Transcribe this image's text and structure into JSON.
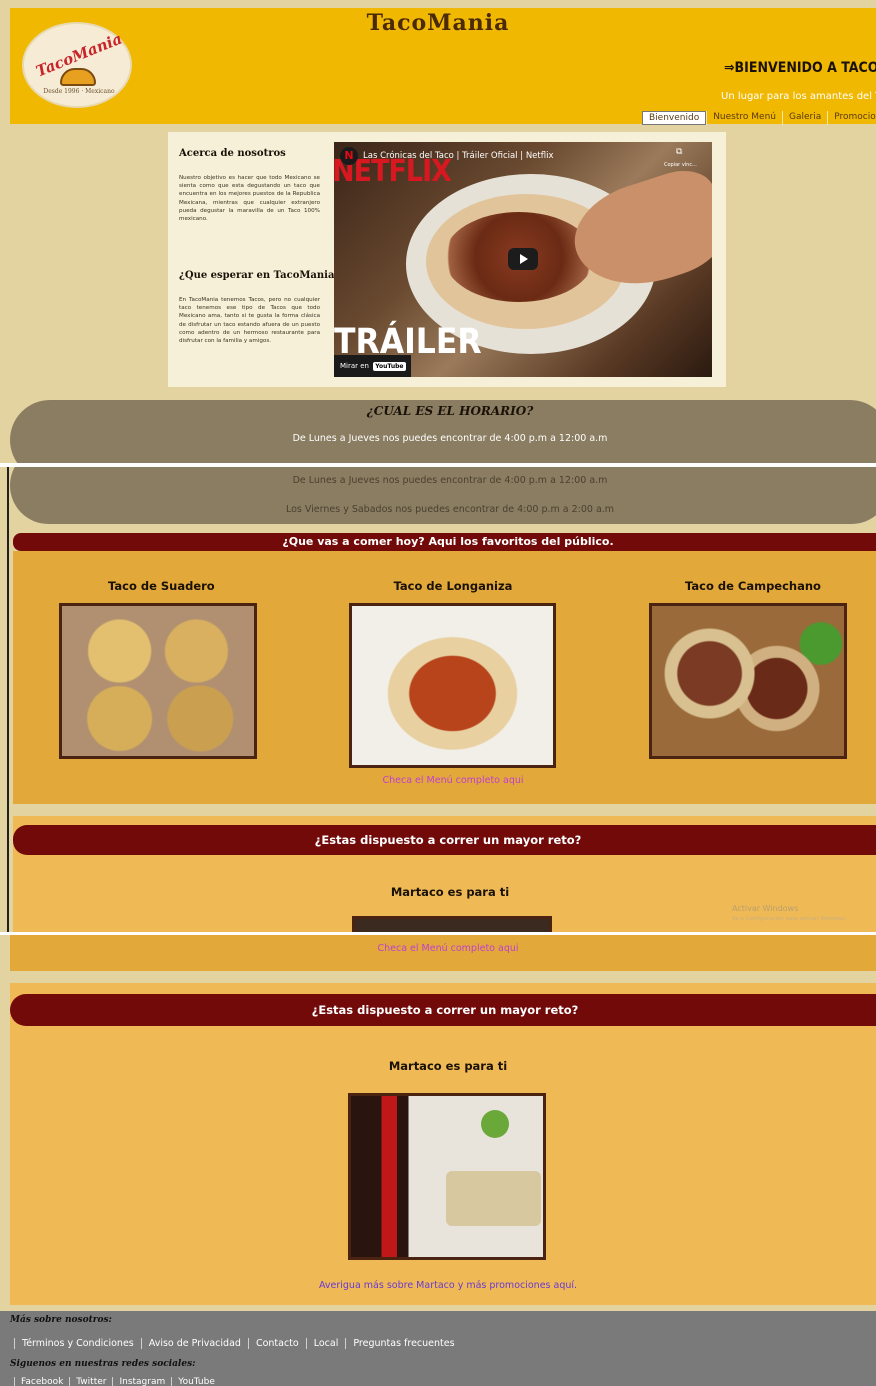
{
  "header": {
    "logo_text": "TacoMania",
    "logo_sub": "Desde 1996 · Mexicano",
    "site_title": "TacoMania",
    "welcome": "⇒BIENVENIDO A TACOMANIA⇐",
    "tagline": "Un lugar para los amantes del Taco",
    "nav": [
      "Bienvenido",
      "Nuestro Menú",
      "Galeria",
      "Promociones"
    ]
  },
  "about": {
    "title": "Acerca de nosotros",
    "text": "Nuestro objetivo es hacer que todo Mexicano se sienta como que esta degustando un taco que encuentra en los mejores puestos de la Republica Mexicana, mientras que cualquier extranjero pueda degustar la maravilla de un Taco 100% mexicano.",
    "expect_title": "¿Que esperar en TacoMania?",
    "expect_text": "En TacoMania tenemos Tacos, pero no cualquier taco tenemos ese tipo de Tacos que todo Mexicano ama, tanto si te gusta la forma clásica de disfrutar un taco estando afuera de un puesto como adentro de un hermoso restaurante para disfrutar con la familia y amigos."
  },
  "video": {
    "channel_icon": "N",
    "title": "Las Crónicas del Taco | Tráiler Oficial | Netflix",
    "copy_label": "Copiar vínc...",
    "brand": "NETFLIX",
    "overlay": "TRÁILER",
    "watch_on": "Mirar en",
    "youtube": "YouTube"
  },
  "schedule": {
    "title": "¿CUAL ES EL HORARIO?",
    "weekdays": "De Lunes a Jueves nos puedes encontrar de 4:00 p.m a 12:00 a.m",
    "weekend": "Los Viernes y Sabados nos puedes encontrar de 4:00 p.m a 2:00 a.m"
  },
  "favorites": {
    "banner": "¿Que vas a comer hoy? Aqui los favoritos del público.",
    "items": [
      {
        "title": "Taco de Suadero"
      },
      {
        "title": "Taco de Longaniza"
      },
      {
        "title": "Taco de Campechano"
      }
    ],
    "menu_link": "Checa el Menú completo aqui"
  },
  "challenge": {
    "banner": "¿Estas dispuesto a correr un mayor reto?",
    "subtitle": "Martaco es para ti",
    "promo_link": "Averigua más sobre Martaco y más promociones aquí."
  },
  "watermark": {
    "title": "Activar Windows",
    "subtitle": "Ve a Configuración para activar Windows."
  },
  "footer": {
    "more_title": "Más sobre nosotros:",
    "links": [
      "Términos y Condiciones",
      "Aviso de Privacidad",
      "Contacto",
      "Local",
      "Preguntas frecuentes"
    ],
    "social_title": "Siguenos en nuestras redes sociales:",
    "social": [
      "Facebook",
      "Twitter",
      "Instagram",
      "YouTube"
    ]
  },
  "colors": {
    "header": "#f0b800",
    "banner": "#720a0a",
    "schedule": "#8b7d62",
    "section": "#e2a83a",
    "footer": "#7a7a7a",
    "link": "#c040d0"
  }
}
